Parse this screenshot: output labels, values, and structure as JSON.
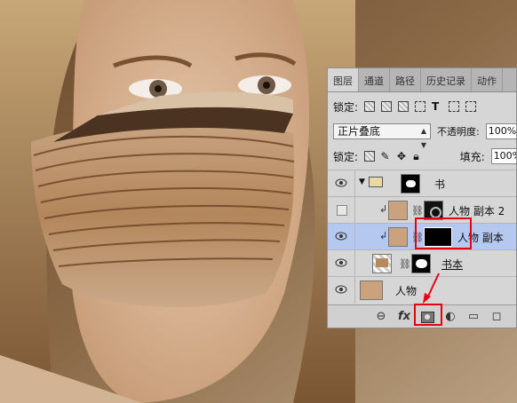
{
  "panel": {
    "tabs": [
      "图层",
      "通道",
      "路径",
      "历史记录",
      "动作"
    ],
    "lock_label": "锁定:",
    "blend_mode": "正片叠底",
    "opacity_label": "不透明度:",
    "opacity_value": "100%",
    "lock_label_2": "锁定:",
    "fill_label": "填充:",
    "fill_value": "100%",
    "layers": [
      {
        "name": "书",
        "kind": "group"
      },
      {
        "name": "人物 副本 2",
        "kind": "clipped-hidden"
      },
      {
        "name": "人物 副本",
        "kind": "clipped-selected"
      },
      {
        "name": "书本",
        "kind": "smart-object"
      },
      {
        "name": "人物",
        "kind": "background"
      }
    ],
    "bottom_icons": [
      "link-icon",
      "fx-icon",
      "add-mask-icon",
      "adjustment-icon",
      "folder-icon",
      "new-layer-icon"
    ],
    "fx_label": "fx"
  },
  "highlight_color": "#e60012",
  "selected_layer_color": "#b4c8f0"
}
